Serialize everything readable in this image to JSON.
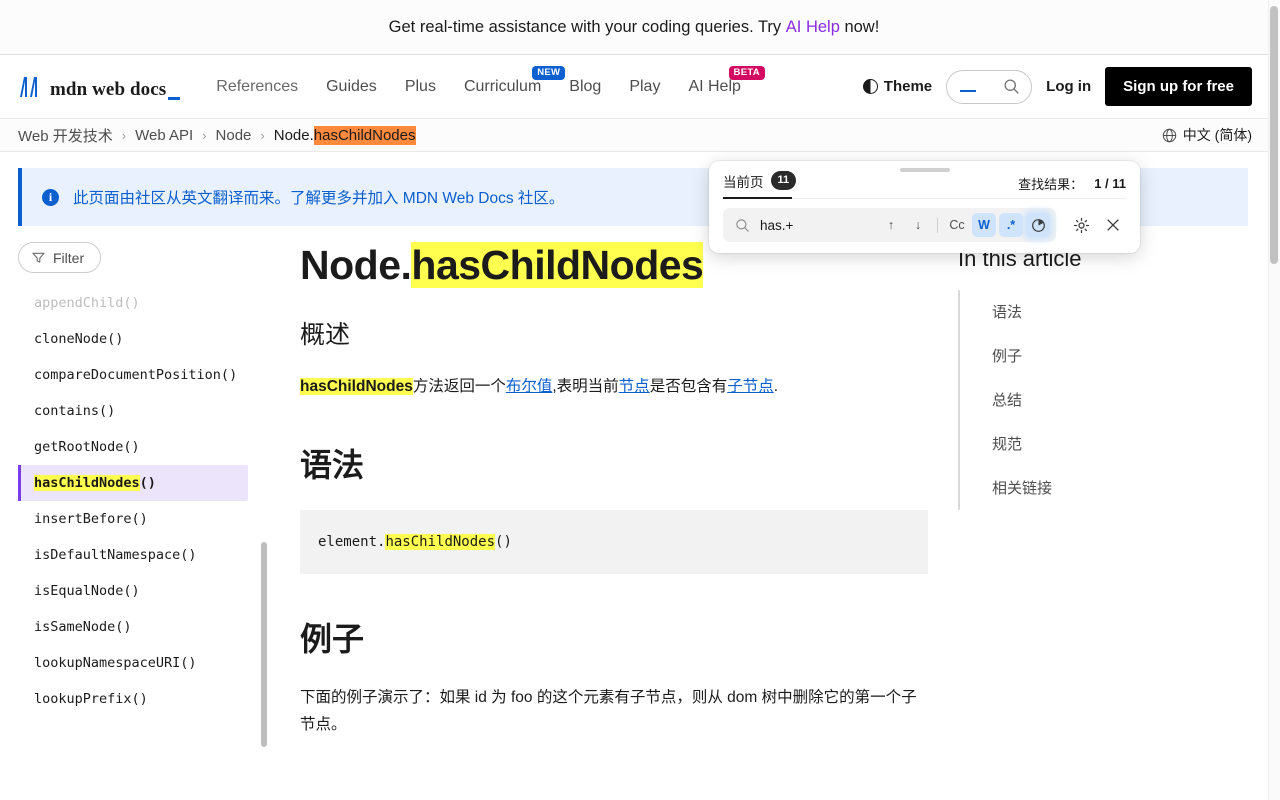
{
  "promo": {
    "before": "Get real-time assistance with your coding queries. Try ",
    "link": "AI Help",
    "after": " now!"
  },
  "header": {
    "logo_text": "mdn web docs",
    "nav": [
      {
        "label": "References",
        "badge": null
      },
      {
        "label": "Guides",
        "badge": null
      },
      {
        "label": "Plus",
        "badge": null
      },
      {
        "label": "Curriculum",
        "badge": "NEW"
      },
      {
        "label": "Blog",
        "badge": null
      },
      {
        "label": "Play",
        "badge": null
      },
      {
        "label": "AI Help",
        "badge": "BETA"
      }
    ],
    "theme_label": "Theme",
    "search_placeholder": "",
    "login_label": "Log in",
    "signup_label": "Sign up for free"
  },
  "breadcrumb": {
    "items": [
      "Web 开发技术",
      "Web API",
      "Node"
    ],
    "separator": "›",
    "current_prefix": "Node.",
    "current_highlight": "hasChildNodes",
    "language": "中文 (简体)"
  },
  "notice": {
    "text": "此页面由社区从英文翻译而来。了解更多并加入 MDN Web Docs 社区。"
  },
  "sidebar": {
    "filter_label": "Filter",
    "items": [
      {
        "label": "appendChild()",
        "state": "faded"
      },
      {
        "label": "cloneNode()",
        "state": "normal"
      },
      {
        "label": "compareDocumentPosition()",
        "state": "normal"
      },
      {
        "label": "contains()",
        "state": "normal"
      },
      {
        "label": "getRootNode()",
        "state": "normal"
      },
      {
        "label": "hasChildNodes()",
        "state": "active",
        "highlight": "hasChildNodes",
        "suffix": "()"
      },
      {
        "label": "insertBefore()",
        "state": "normal"
      },
      {
        "label": "isDefaultNamespace()",
        "state": "normal"
      },
      {
        "label": "isEqualNode()",
        "state": "normal"
      },
      {
        "label": "isSameNode()",
        "state": "normal"
      },
      {
        "label": "lookupNamespaceURI()",
        "state": "normal"
      },
      {
        "label": "lookupPrefix()",
        "state": "normal"
      }
    ]
  },
  "article": {
    "title_prefix": "Node.",
    "title_highlight": "hasChildNodes",
    "overview_heading": "概述",
    "overview": {
      "term": "hasChildNodes",
      "t1": "方法返回一个",
      "link1": "布尔值",
      "t2": ",表明当前",
      "link2": "节点",
      "t3": "是否包含有",
      "link3": "子节点",
      "t4": "."
    },
    "syntax_heading": "语法",
    "code": {
      "prefix": "element.",
      "highlight": "hasChildNodes",
      "suffix": "()"
    },
    "examples_heading": "例子",
    "examples_text": "下面的例子演示了：如果 id 为 foo 的这个元素有子节点，则从 dom 树中删除它的第一个子节点。"
  },
  "toc": {
    "title": "In this article",
    "items": [
      "语法",
      "例子",
      "总结",
      "规范",
      "相关链接"
    ]
  },
  "findbar": {
    "tab_label": "当前页",
    "tab_count": "11",
    "results_label": "查找结果：",
    "results_value": "1 / 11",
    "query": "has.+",
    "tools": {
      "prev": "↑",
      "next": "↓",
      "case": "Cc",
      "word": "W",
      "regex": ".*"
    }
  },
  "colors": {
    "accent_blue": "#0b5fce",
    "badge_new": "#0b5fce",
    "badge_beta": "#d30b63",
    "promo_link": "#8a2be2",
    "highlight_yellow": "#ffff4f",
    "highlight_orange": "#ff8a3d",
    "active_purple": "#ece4fb"
  }
}
